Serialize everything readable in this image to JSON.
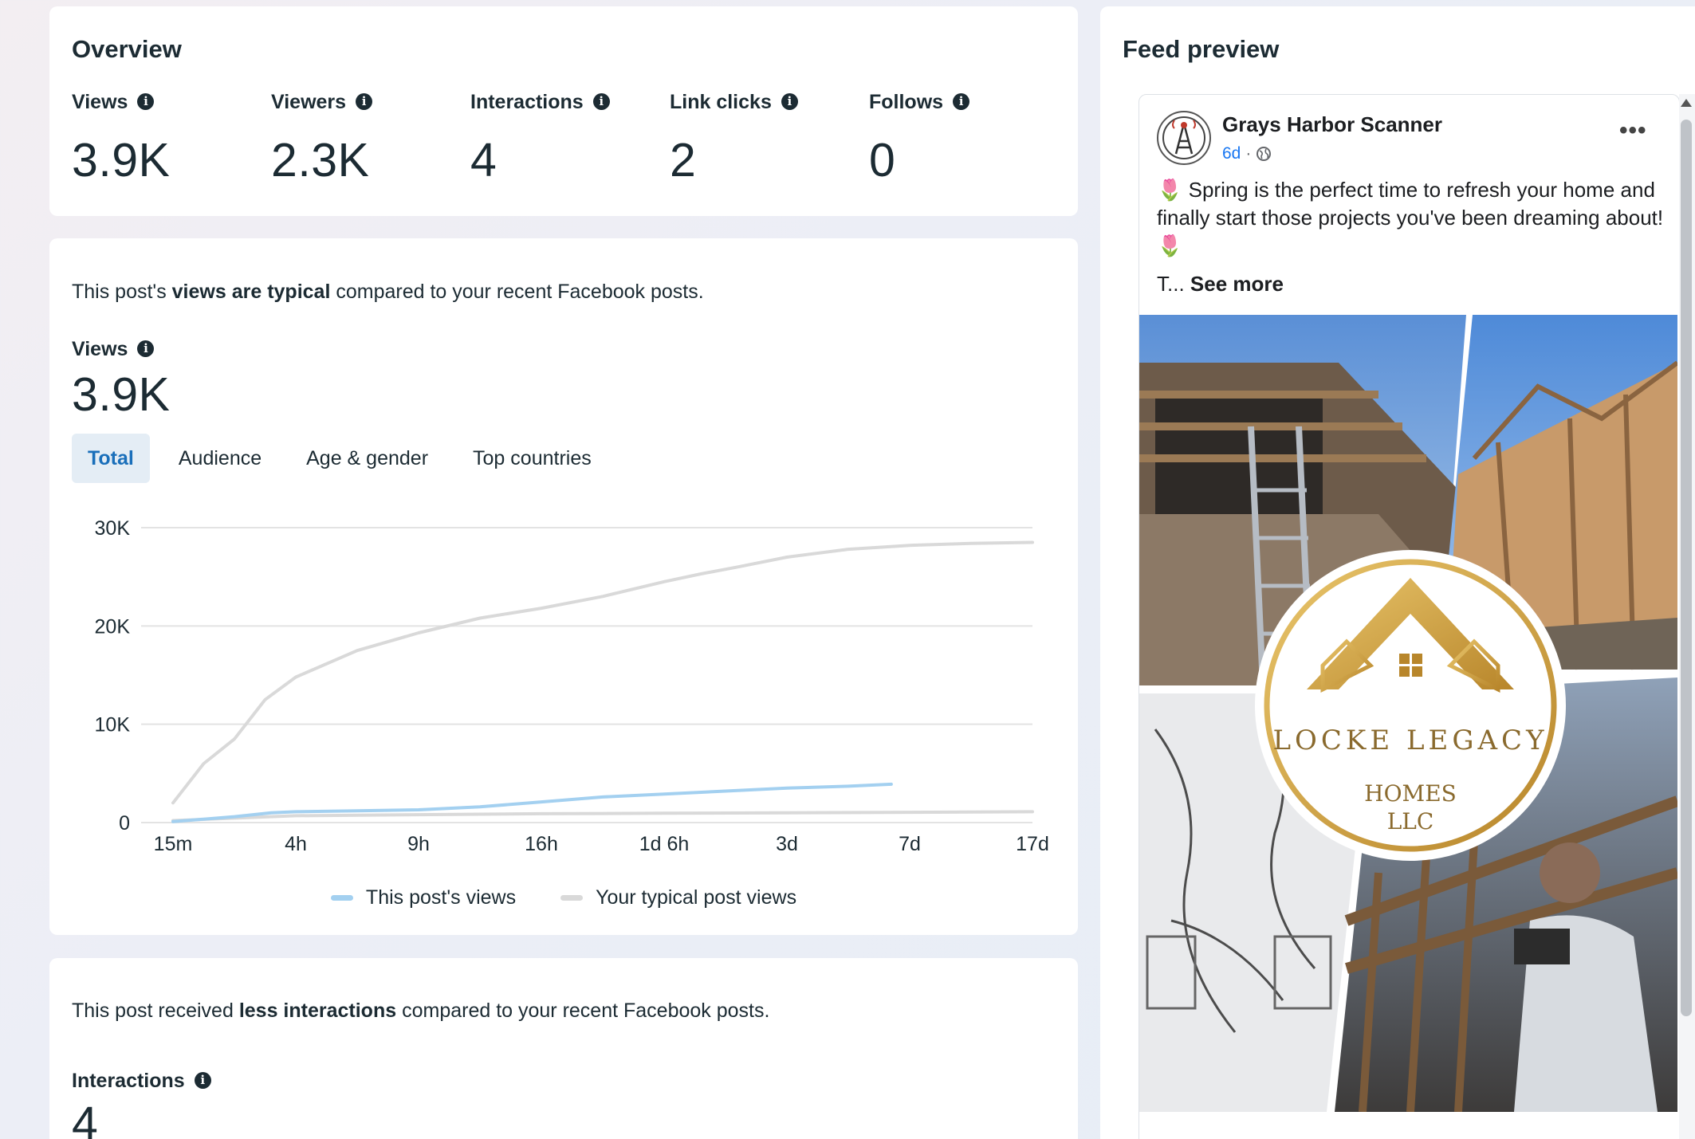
{
  "overview": {
    "title": "Overview",
    "stats": [
      {
        "label": "Views",
        "value": "3.9K"
      },
      {
        "label": "Viewers",
        "value": "2.3K"
      },
      {
        "label": "Interactions",
        "value": "4"
      },
      {
        "label": "Link clicks",
        "value": "2"
      },
      {
        "label": "Follows",
        "value": "0"
      }
    ]
  },
  "views_section": {
    "sentence_pre": "This post's ",
    "sentence_bold": "views are typical",
    "sentence_post": " compared to your recent Facebook posts.",
    "metric_label": "Views",
    "metric_value": "3.9K",
    "tabs": [
      "Total",
      "Audience",
      "Age & gender",
      "Top countries"
    ],
    "active_tab": "Total",
    "legend": [
      {
        "label": "This post's views",
        "color": "#a3d0f0"
      },
      {
        "label": "Your typical post views",
        "color": "#d9d9d9"
      }
    ]
  },
  "interactions_section": {
    "sentence_pre": "This post received ",
    "sentence_bold": "less interactions",
    "sentence_post": " compared to your recent Facebook posts.",
    "metric_label": "Interactions",
    "metric_value": "4"
  },
  "feed_preview": {
    "title": "Feed preview",
    "page_name": "Grays Harbor Scanner",
    "time": "6d",
    "separator": "·",
    "body_emoji": "🌷",
    "body_text": "Spring is the perfect time to refresh your home and finally start those projects you've been dreaming about!",
    "truncated": "T...",
    "see_more": "See more",
    "menu_glyph": "•••",
    "logo_text_line1": "LOCKE LEGACY",
    "logo_text_line2": "HOMES",
    "logo_text_line3": "LLC"
  },
  "chart_data": {
    "type": "line",
    "x_ticks": [
      "15m",
      "4h",
      "9h",
      "16h",
      "1d 6h",
      "3d",
      "7d",
      "17d"
    ],
    "y_ticks": [
      "30K",
      "20K",
      "10K",
      "0"
    ],
    "ylim": [
      0,
      30000
    ],
    "grid": true,
    "legend_position": "bottom",
    "series": [
      {
        "name": "This post's views",
        "color": "#a3d0f0",
        "x_index": [
          0,
          0.5,
          0.8,
          1,
          1.5,
          2,
          2.5,
          3,
          3.5,
          4,
          4.5,
          5,
          5.5,
          5.85
        ],
        "values": [
          100,
          600,
          1000,
          1100,
          1200,
          1300,
          1600,
          2100,
          2600,
          2900,
          3200,
          3500,
          3700,
          3900
        ]
      },
      {
        "name": "Your typical post views",
        "color": "#d9d9d9",
        "x_index": [
          0,
          0.25,
          0.5,
          0.75,
          1,
          1.5,
          2,
          2.5,
          3,
          3.5,
          4,
          4.3,
          4.6,
          5,
          5.5,
          6,
          6.5,
          7
        ],
        "values": [
          2000,
          6000,
          8500,
          12500,
          14800,
          17500,
          19300,
          20800,
          21800,
          23000,
          24500,
          25300,
          26000,
          27000,
          27800,
          28200,
          28400,
          28500
        ]
      },
      {
        "name": "",
        "color": "#d9d9d9",
        "x_index": [
          0,
          1,
          2,
          3,
          4,
          5,
          6,
          7
        ],
        "values": [
          200,
          700,
          800,
          900,
          950,
          1000,
          1050,
          1100
        ]
      }
    ]
  }
}
